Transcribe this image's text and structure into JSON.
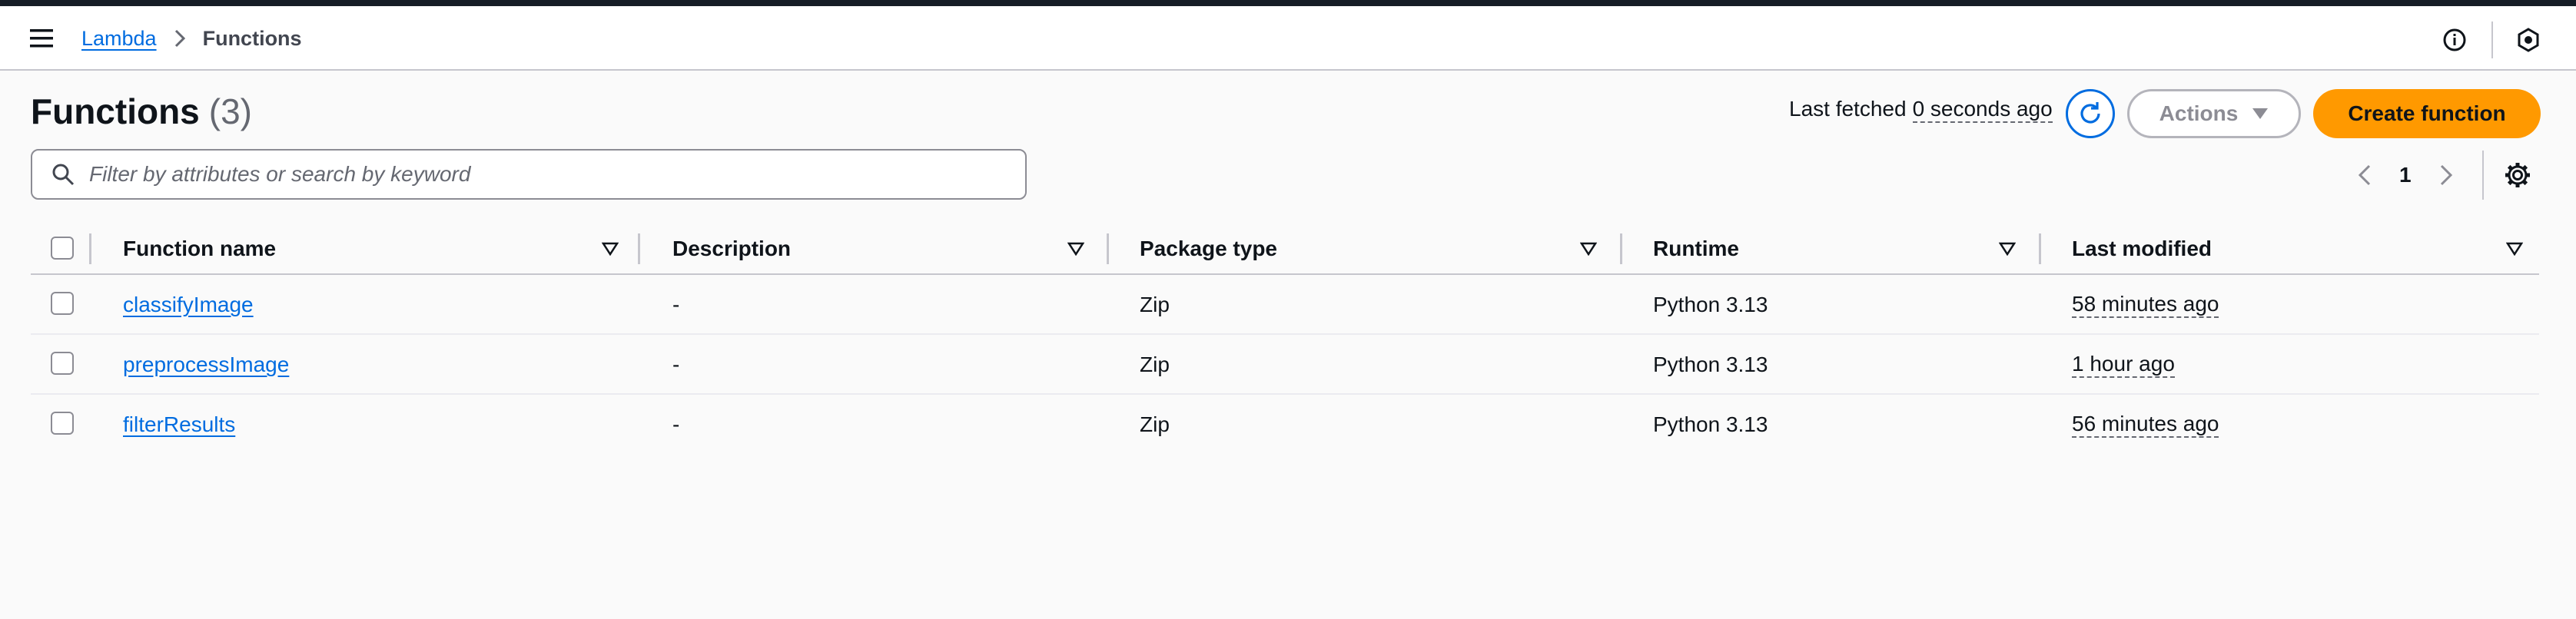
{
  "header": {
    "breadcrumb": [
      {
        "label": "Lambda"
      },
      {
        "label": "Functions"
      }
    ],
    "icons": [
      "menu-icon",
      "chevron-right-icon",
      "info-icon",
      "notifications-icon"
    ]
  },
  "page": {
    "title": "Functions",
    "count": "(3)",
    "last_fetched_label": "Last fetched",
    "last_fetched_value": "0 seconds ago",
    "actions_label": "Actions",
    "create_label": "Create function"
  },
  "search": {
    "placeholder": "Filter by attributes or search by keyword",
    "value": ""
  },
  "pagination": {
    "current_page": "1"
  },
  "table": {
    "columns": [
      "Function name",
      "Description",
      "Package type",
      "Runtime",
      "Last modified"
    ],
    "rows": [
      {
        "name": "classifyImage",
        "description": "-",
        "package_type": "Zip",
        "runtime": "Python 3.13",
        "last_modified": "58 minutes ago"
      },
      {
        "name": "preprocessImage",
        "description": "-",
        "package_type": "Zip",
        "runtime": "Python 3.13",
        "last_modified": "1 hour ago"
      },
      {
        "name": "filterResults",
        "description": "-",
        "package_type": "Zip",
        "runtime": "Python 3.13",
        "last_modified": "56 minutes ago"
      }
    ]
  },
  "colors": {
    "accent": "#006ce0",
    "primary_button": "#ff9900",
    "top_bar": "#161d26"
  }
}
